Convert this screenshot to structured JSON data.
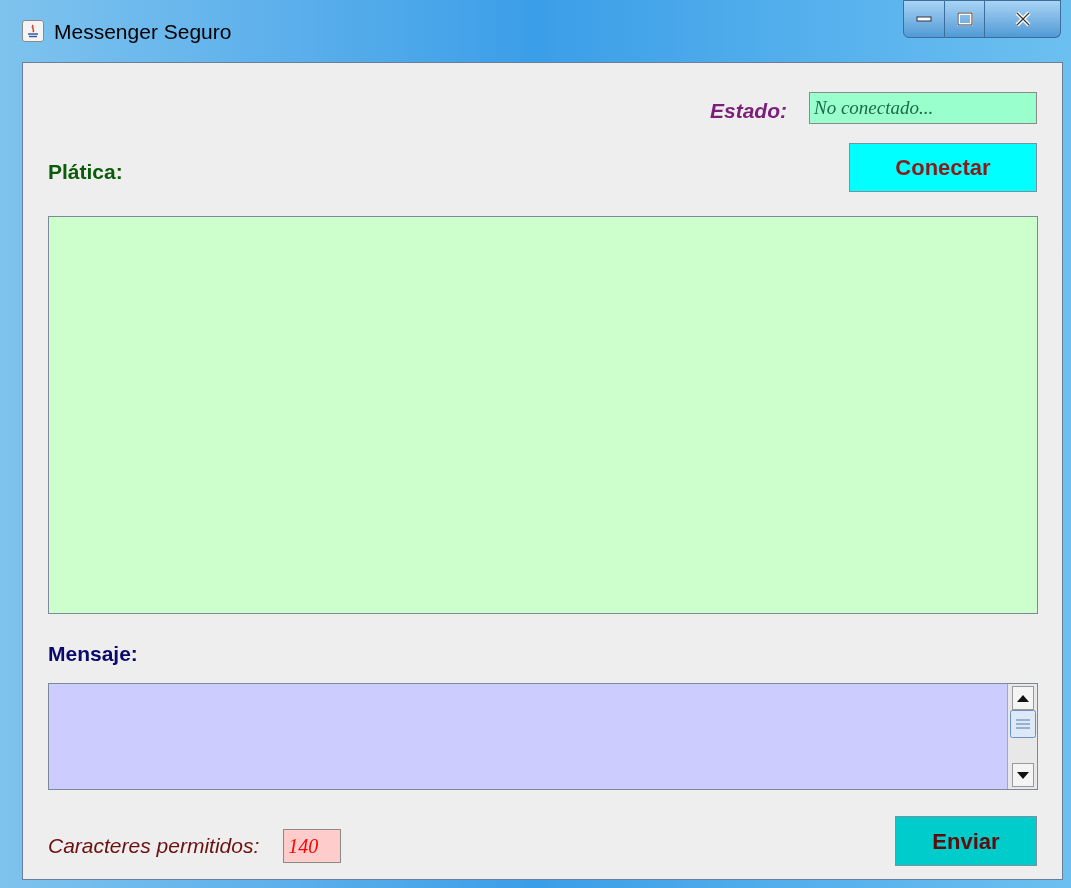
{
  "window": {
    "title": "Messenger Seguro"
  },
  "status": {
    "label": "Estado:",
    "value": "No conectado..."
  },
  "connect_button": {
    "label": "Conectar"
  },
  "chat": {
    "label": "Plática:"
  },
  "message": {
    "label": "Mensaje:"
  },
  "char_limit": {
    "label": "Caracteres permitidos:",
    "value": "140"
  },
  "send_button": {
    "label": "Enviar"
  }
}
